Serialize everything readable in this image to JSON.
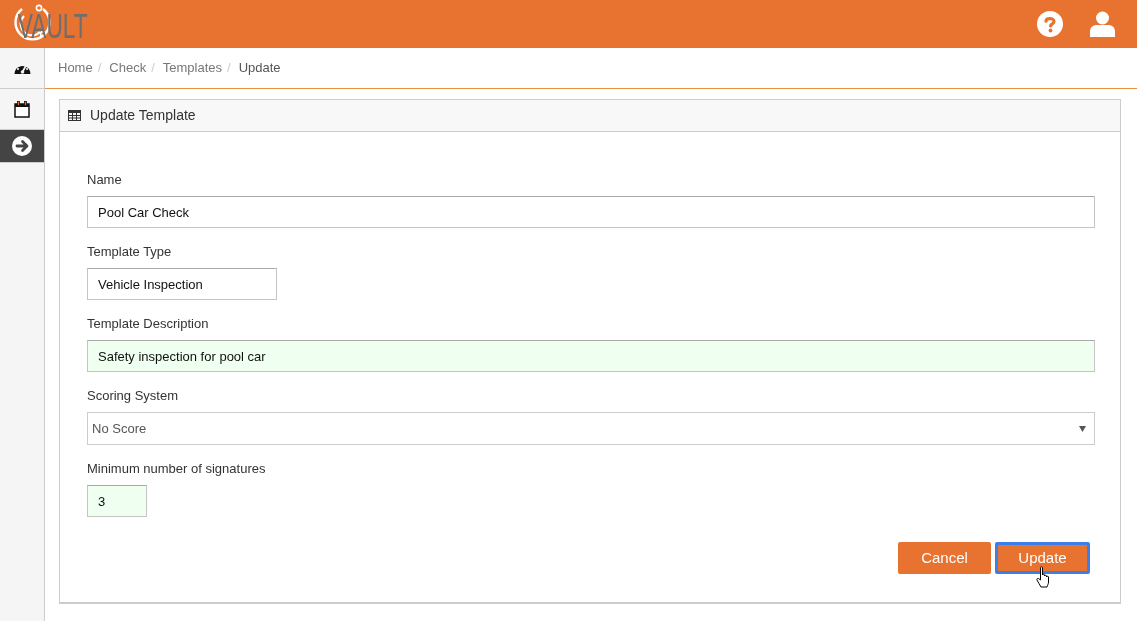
{
  "header": {
    "logo": "VAULT"
  },
  "sidebar": {
    "items": [
      {
        "selected": false
      },
      {
        "selected": false
      },
      {
        "selected": true
      }
    ]
  },
  "breadcrumb": [
    {
      "label": "Home",
      "current": false,
      "separator": "/"
    },
    {
      "label": "Check",
      "current": false,
      "separator": "/"
    },
    {
      "label": "Templates",
      "current": false,
      "separator": "/"
    },
    {
      "label": "Update",
      "current": true
    }
  ],
  "panel": {
    "title": "Update Template",
    "fields": [
      {
        "kind": "text",
        "label": "Name",
        "value": "Pool Car Check",
        "valid": false
      },
      {
        "kind": "text",
        "label": "Template Type",
        "value": "Vehicle Inspection",
        "valid": false
      },
      {
        "kind": "text",
        "label": "Template Description",
        "value": "Safety inspection for pool car",
        "valid": true
      },
      {
        "kind": "select",
        "label": "Scoring System",
        "value": "No Score",
        "valid": false
      },
      {
        "kind": "text",
        "label": "Minimum number of signatures",
        "value": "3",
        "valid": true
      }
    ],
    "buttons": [
      {
        "label": "Cancel",
        "focused": false,
        "hovered": false
      },
      {
        "label": "Update",
        "focused": true,
        "hovered": true
      }
    ]
  }
}
